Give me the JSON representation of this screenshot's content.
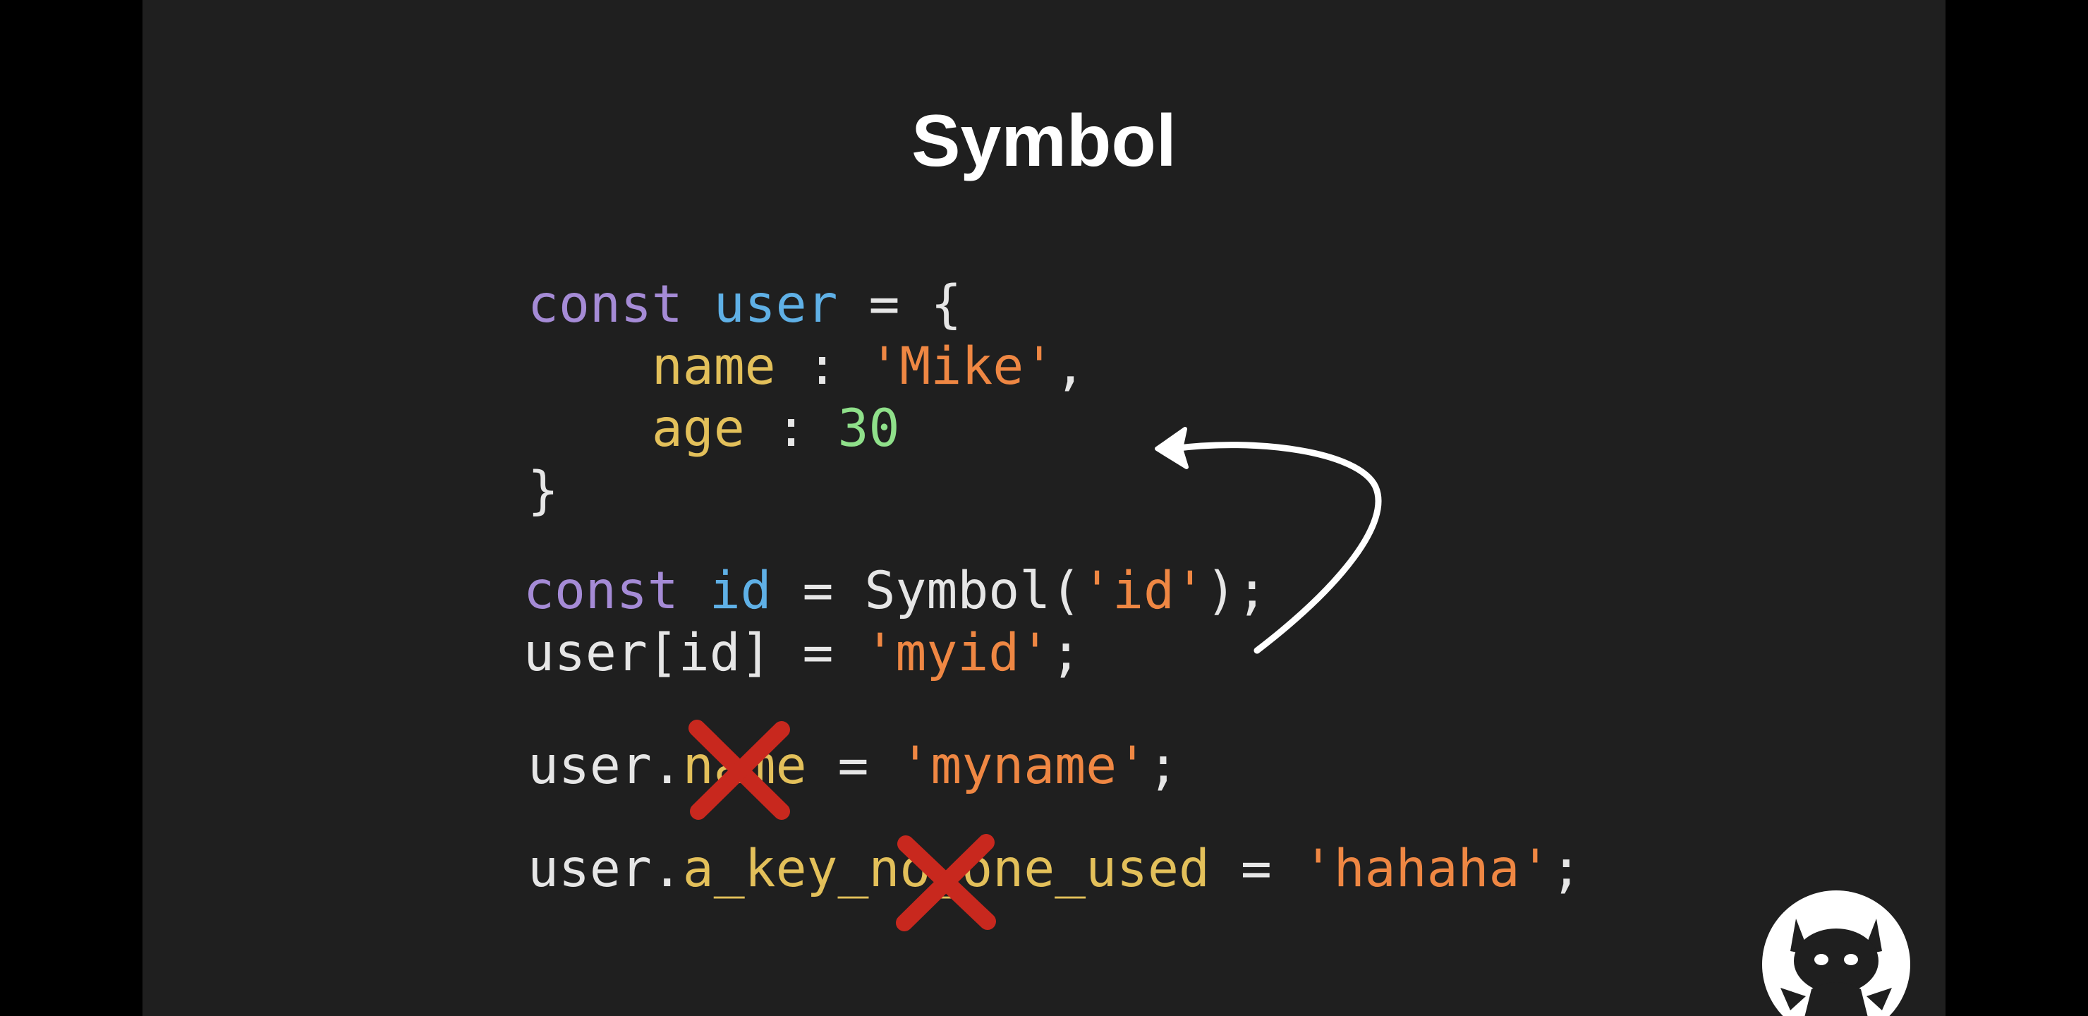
{
  "slide": {
    "title": "Symbol"
  },
  "code": {
    "l1": {
      "kw": "const",
      "sp1": " ",
      "var": "user",
      "rest": " = {"
    },
    "l2": {
      "indent": "    ",
      "prop": "name",
      "mid": " : ",
      "str": "'Mike'",
      "end": ","
    },
    "l3": {
      "indent": "    ",
      "prop": "age",
      "mid": " : ",
      "num": "30"
    },
    "l4": {
      "text": "}"
    },
    "l5": {
      "kw": "const",
      "sp1": " ",
      "var": "id",
      "eq": " = ",
      "fn": "Symbol(",
      "str": "'id'",
      "end": ");"
    },
    "l6": {
      "obj": "user[id]",
      "eq": " = ",
      "str": "'myid'",
      "end": ";"
    },
    "l7": {
      "obj": "user.",
      "prop": "name",
      "eq": " = ",
      "str": "'myname'",
      "end": ";"
    },
    "l8": {
      "obj": "user.",
      "prop": "a_key_no_one_used",
      "eq": " = ",
      "str": "'hahaha'",
      "end": ";"
    }
  },
  "colors": {
    "background": "#1f1f1f",
    "keyword": "#a58bd6",
    "variable": "#5fb0e6",
    "property": "#e3c05a",
    "string": "#ef8743",
    "number": "#8fe08a",
    "cross_mark": "#c8281e"
  },
  "icons": {
    "arrow": "curved-arrow-icon",
    "cross": "red-x-mark-icon",
    "avatar": "devil-cat-avatar-icon"
  }
}
